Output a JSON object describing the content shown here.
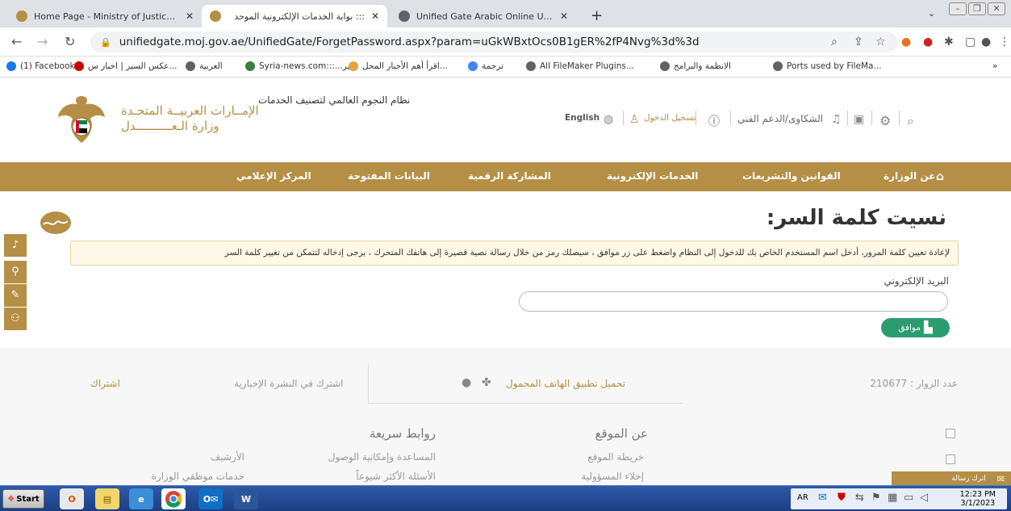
{
  "browser": {
    "tabs": [
      {
        "title": "Home Page - Ministry of Justice - U/",
        "active": false
      },
      {
        "title": "::: بوابة الخدمات الإلكترونية الموحد",
        "active": true
      },
      {
        "title": "Unified Gate Arabic Online User Ma",
        "active": false
      }
    ],
    "new_tab": "+",
    "url": "unifiedgate.moj.gov.ae/UnifiedGate/ForgetPassword.aspx?param=uGkWBxtOcs0B1gER%2fP4Nvg%3d%3d",
    "bookmarks": [
      "(1) Facebook",
      "عكس السير | اخبار س...",
      "العربية",
      "Syria-news.com:::...سير",
      "اقرأ أهم الأخبار المحل...",
      "ترجمة",
      "All FileMaker Plugins...",
      "الانظمة والبرامج",
      "Ports used by FileMa..."
    ],
    "bookmarks_more": "»"
  },
  "site": {
    "ministry_line1": "الإمــارات العربيــة المتحـدة",
    "ministry_line2": "وزارة الـعــــــــــدل",
    "stars_alt": "نظام النجوم العالمي لتصنيف الخدمات",
    "english": "English",
    "login": "تسجيل الدخول",
    "complaints": "الشكاوى/الدعم الفني",
    "nav": [
      "عن الوزارة",
      "القوانين والتشريعات",
      "الخدمات الإلكترونية",
      "المشاركة الرقمية",
      "البيانات المفتوحة",
      "المركز الإعلامي"
    ]
  },
  "content": {
    "title": "نسيت كلمة السر:",
    "notice": "لإعادة تعيين كلمة المرور، أدخل اسم المستخدم الخاص بك للدخول إلى النظام واضغط على زر موافق ، سيصلك رمز من خلال رسالة نصية قصيرة إلى هاتفك المتحرك ، يرجى إدخاله لتتمكن من تغيير كلمة السر",
    "email_label": "البريد الإلكتروني",
    "email_value": "",
    "ok_button": "موافق"
  },
  "footer": {
    "visitors_label": "عدد الزوار",
    "visitors_count": "210677",
    "mobile_app": "تحميل تطبيق الهاتف المحمول",
    "newsletter": "اشترك في النشرة الإخبارية",
    "subscribe": "اشتراك",
    "about_head": "عن الموقع",
    "about_links": [
      "خريطة الموقع",
      "إخلاء المسؤولية"
    ],
    "quick_head": "روابط سريعة",
    "quick_col1": [
      "المساعدة وإمكانية الوصول",
      "الأسئلة الأكثر شيوعاً"
    ],
    "quick_col2": [
      "الأرشيف",
      "خدمات موظفي الوزارة"
    ],
    "send_message": "اترك رسالة"
  },
  "taskbar": {
    "start": "Start",
    "lang": "AR",
    "time": "12:23 PM",
    "date": "3/1/2023"
  },
  "colors": {
    "brand_gold": "#b48f45",
    "ok_green": "#2a9d6f",
    "notice_bg": "#fdf9e6"
  }
}
